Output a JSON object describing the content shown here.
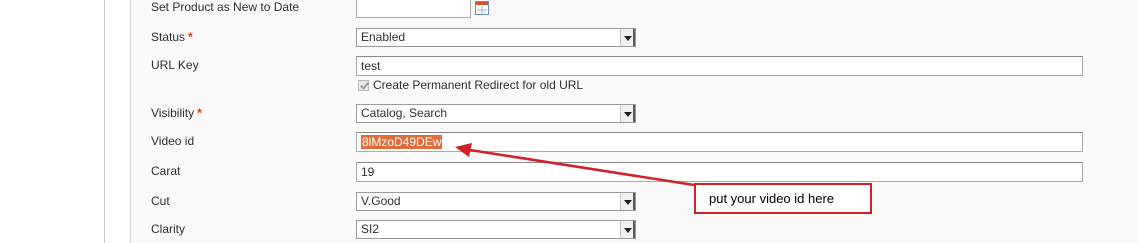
{
  "form": {
    "new_to_date": {
      "label": "Set Product as New to Date",
      "value": ""
    },
    "status": {
      "label": "Status",
      "required_mark": "*",
      "value": "Enabled"
    },
    "url_key": {
      "label": "URL Key",
      "value": "test",
      "redirect_checkbox_label": "Create Permanent Redirect for old URL",
      "redirect_checked": true
    },
    "visibility": {
      "label": "Visibility",
      "required_mark": "*",
      "value": "Catalog, Search"
    },
    "video_id": {
      "label": "Video id",
      "value": "8lMzoD49DEw"
    },
    "carat": {
      "label": "Carat",
      "value": "19"
    },
    "cut": {
      "label": "Cut",
      "value": "V.Good"
    },
    "clarity": {
      "label": "Clarity",
      "value": "SI2"
    }
  },
  "annotation": {
    "callout_text": "put your video id here",
    "color": "#d0202a"
  },
  "icons": {
    "calendar": "calendar-icon",
    "dropdown": "chevron-down-icon"
  },
  "colors": {
    "required": "#eb340a",
    "selection": "#e06c3a"
  }
}
